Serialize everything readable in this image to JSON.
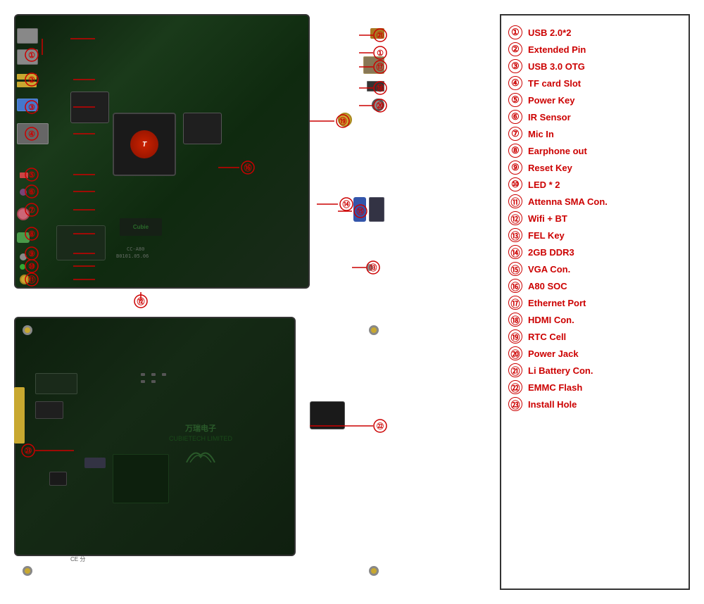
{
  "legend": {
    "items": [
      {
        "num": "①",
        "label": "USB 2.0*2"
      },
      {
        "num": "②",
        "label": "Extended Pin"
      },
      {
        "num": "③",
        "label": "USB 3.0 OTG"
      },
      {
        "num": "④",
        "label": "TF card Slot"
      },
      {
        "num": "⑤",
        "label": "Power Key"
      },
      {
        "num": "⑥",
        "label": "IR Sensor"
      },
      {
        "num": "⑦",
        "label": "Mic In"
      },
      {
        "num": "⑧",
        "label": "Earphone out"
      },
      {
        "num": "⑨",
        "label": "Reset Key"
      },
      {
        "num": "⑩",
        "label": "LED * 2"
      },
      {
        "num": "⑪",
        "label": "Attenna SMA Con."
      },
      {
        "num": "⑫",
        "label": "Wifi + BT"
      },
      {
        "num": "⑬",
        "label": "FEL Key"
      },
      {
        "num": "⑭",
        "label": "2GB DDR3"
      },
      {
        "num": "⑮",
        "label": "VGA Con."
      },
      {
        "num": "⑯",
        "label": "A80 SOC"
      },
      {
        "num": "⑰",
        "label": "Ethernet Port"
      },
      {
        "num": "⑱",
        "label": "HDMI Con."
      },
      {
        "num": "⑲",
        "label": "RTC Cell"
      },
      {
        "num": "⑳",
        "label": "Power Jack"
      },
      {
        "num": "㉑",
        "label": "Li Battery Con."
      },
      {
        "num": "㉒",
        "label": "EMMC Flash"
      },
      {
        "num": "㉓",
        "label": "Install Hole"
      }
    ]
  },
  "board": {
    "top_alt": "A80 OptimusBoard Top View",
    "bottom_alt": "A80 OptimusBoard Bottom View"
  }
}
